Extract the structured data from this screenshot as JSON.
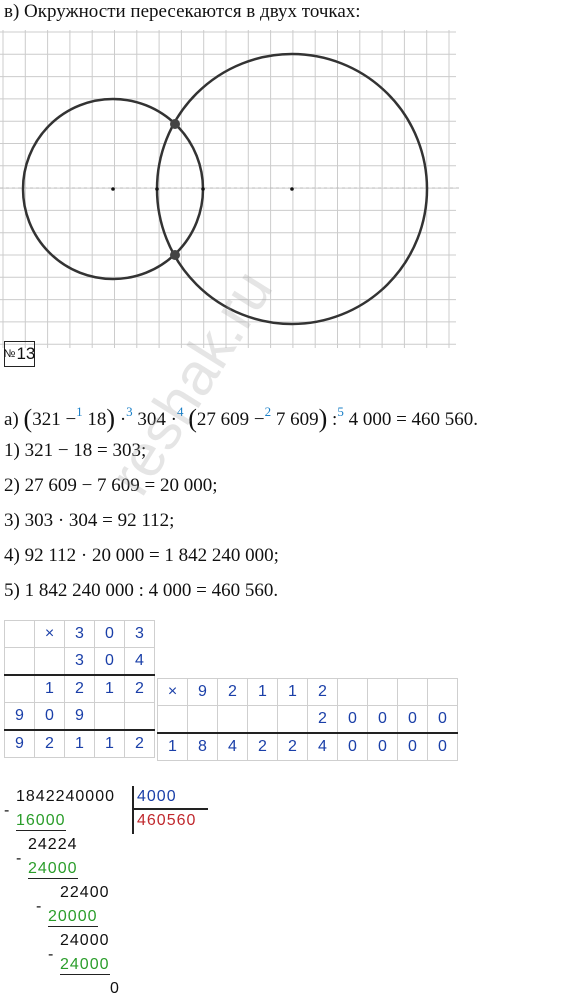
{
  "heading": "в) Окружности пересекаются в двух точках:",
  "problem": {
    "no_label": "№",
    "number": "13"
  },
  "equation": {
    "prefix": "a)",
    "a": "321 −",
    "b": "18",
    "c": "304 ·",
    "d": "27 609 −",
    "e": "7 609",
    "f": "4 000 = 460 560.",
    "dot": "·",
    "colon": ":",
    "order": [
      "1",
      "3",
      "4",
      "2",
      "5"
    ]
  },
  "steps": [
    "1) 321 − 18 = 303;",
    "2) 27 609 − 7 609 = 20 000;",
    "3) 303 · 304 = 92 112;",
    "4) 92 112 · 20 000 = 1 842 240 000;",
    "5) 1 842 240 000 : 4 000 = 460 560."
  ],
  "mult1": {
    "sign": "×",
    "rows": [
      [
        "",
        "×",
        "3",
        "0",
        "3"
      ],
      [
        "",
        "",
        "3",
        "0",
        "4"
      ],
      [
        "",
        "1",
        "2",
        "1",
        "2"
      ],
      [
        "9",
        "0",
        "9",
        "",
        ""
      ],
      [
        "9",
        "2",
        "1",
        "1",
        "2"
      ]
    ]
  },
  "mult2": {
    "rows": [
      [
        "×",
        "9",
        "2",
        "1",
        "1",
        "2",
        "",
        "",
        "",
        ""
      ],
      [
        "",
        "",
        "",
        "",
        "",
        "2",
        "0",
        "0",
        "0",
        "0"
      ],
      [
        "1",
        "8",
        "4",
        "2",
        "2",
        "4",
        "0",
        "0",
        "0",
        "0"
      ]
    ]
  },
  "division": {
    "dividend": "1842240000",
    "divisor": "4000",
    "quotient": "460560",
    "minus": "-",
    "steps": [
      {
        "sub": "16000",
        "rem": "24224"
      },
      {
        "sub": "24000",
        "rem": "22400"
      },
      {
        "sub": "20000",
        "rem": "24000"
      },
      {
        "sub": "24000",
        "rem": "0"
      }
    ]
  },
  "watermark": "reshak.ru",
  "colors": {
    "grid": "#cccccc",
    "ink": "#333333",
    "blue": "#1a3fa8",
    "green": "#2a9d2a",
    "red": "#c0282d",
    "sup": "#1a7fc7"
  }
}
